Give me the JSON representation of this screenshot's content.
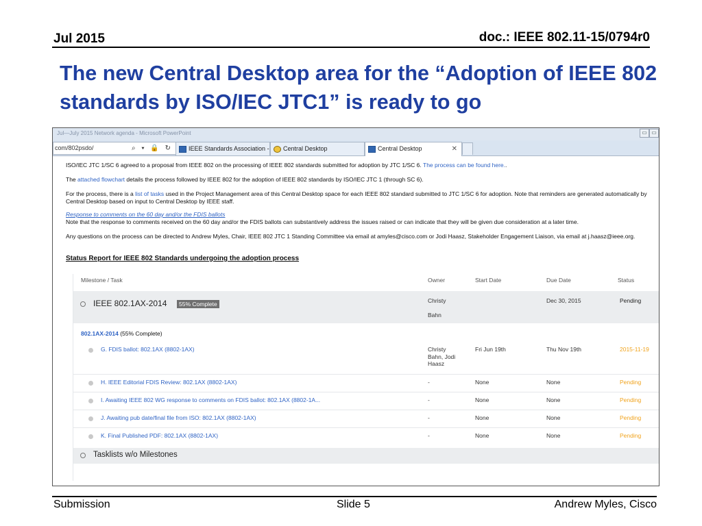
{
  "header": {
    "date": "Jul 2015",
    "doc": "doc.: IEEE 802.11-15/0794r0"
  },
  "title": "The new Central Desktop area for the “Adoption of IEEE 802 standards by ISO/IEC JTC1” is ready to go",
  "browser": {
    "window_caption": "Jul—July 2015 Network agenda - Microsoft PowerPoint",
    "address": "com/802psdo/",
    "address_icons": "⌕ ▾ 🔒 ↻",
    "tabs": [
      {
        "label": "IEEE Standards Association - D...",
        "icon": "ieee-favicon"
      },
      {
        "label": "Central Desktop",
        "icon": "ie-favicon"
      },
      {
        "label": "Central Desktop",
        "icon": "ieee-favicon",
        "close": "✕"
      }
    ],
    "window_buttons": [
      "▭",
      "▭"
    ]
  },
  "page": {
    "p1_text": "ISO/IEC JTC 1/SC 6 agreed to a proposal from IEEE 802 on the processing of IEEE 802 standards submitted for adoption by JTC 1/SC 6.",
    "p1_link": "The process can be found here.",
    "p1_end": ".",
    "p2_pre": "The",
    "p2_link": "attached flowchart",
    "p2_post": "details the process followed by IEEE 802 for the adoption of IEEE 802 standards by ISO/IEC JTC 1 (through SC 6).",
    "p3_pre": "For the process, there is a",
    "p3_link": "list of tasks",
    "p3_post": "used in the Project Management area of this Central Desktop space for each IEEE 802 standard submitted to JTC 1/SC 6 for adoption.  Note that reminders are generated automatically by Central Desktop based on input to Central Desktop by IEEE staff.",
    "p4_link": "Response to comments on the 60 day and/or the FDIS ballots",
    "p4_text": "Note that the response to comments received on the 60 day and/or the FDIS ballots can substantively address the issues raised or can indicate that they will be given due consideration at a later time.",
    "p5_text": "Any questions on the process can be directed to Andrew Myles, Chair, IEEE 802 JTC 1 Standing Committee via email at amyles@cisco.com or Jodi Haasz, Stakeholder Engagement Liaison, via email at j.haasz@ieee.org.",
    "status_title": "Status Report for IEEE 802 Standards undergoing the adoption process"
  },
  "table": {
    "headers": {
      "task": "Milestone / Task",
      "owner": "Owner",
      "start": "Start Date",
      "due": "Due Date",
      "status": "Status"
    },
    "milestone": {
      "name": "IEEE 802.1AX-2014",
      "badge": "55% Complete",
      "owner_line1": "Christy",
      "owner_line2": "Bahn",
      "due": "Dec 30, 2015",
      "status": "Pending"
    },
    "sub_heading": {
      "link": "802.1AX-2014",
      "text": "(55% Complete)"
    },
    "rows": [
      {
        "task": "G. FDIS ballot: 802.1AX (8802-1AX)",
        "owner": [
          "Christy",
          "Bahn, Jodi",
          "Haasz"
        ],
        "start": "Fri Jun 19th",
        "due": "Thu Nov 19th",
        "status": "2015-11-19"
      },
      {
        "task": "H. IEEE Editorial FDIS Review: 802.1AX (8802-1AX)",
        "owner": [
          "-"
        ],
        "start": "None",
        "due": "None",
        "status": "Pending"
      },
      {
        "task": "I. Awaiting IEEE 802 WG response to comments on FDIS ballot: 802.1AX (8802-1A...",
        "owner": [
          "-"
        ],
        "start": "None",
        "due": "None",
        "status": "Pending"
      },
      {
        "task": "J. Awaiting pub date/final file from ISO: 802.1AX (8802-1AX)",
        "owner": [
          "-"
        ],
        "start": "None",
        "due": "None",
        "status": "Pending"
      },
      {
        "task": "K. Final Published PDF: 802.1AX (8802-1AX)",
        "owner": [
          "-"
        ],
        "start": "None",
        "due": "None",
        "status": "Pending"
      }
    ],
    "tasklists": "Tasklists w/o Milestones"
  },
  "footer": {
    "left": "Submission",
    "mid": "Slide 5",
    "right": "Andrew Myles, Cisco"
  },
  "colors": {
    "title": "#1f3fa0",
    "link": "#2f63c4",
    "pending": "#f0a21b"
  }
}
